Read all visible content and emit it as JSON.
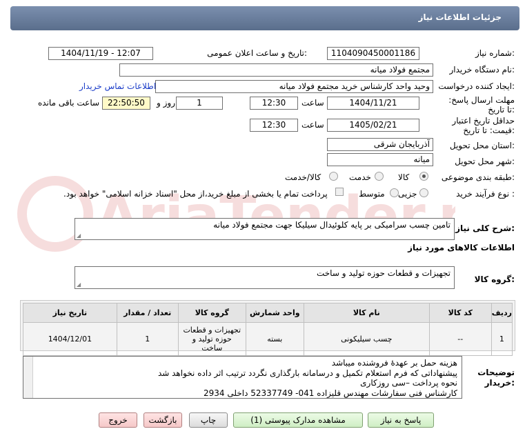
{
  "header": {
    "title": "جزئیات اطلاعات نیاز"
  },
  "fields": {
    "need_number_label": "شماره نیاز:",
    "need_number": "1104090450001186",
    "announce_label": "تاریخ و ساعت اعلان عمومی:",
    "announce_value": "1404/11/19 - 12:07",
    "buyer_label": "نام دستگاه خریدار:",
    "buyer_value": "مجتمع فولاد میانه",
    "creator_label": "ایجاد کننده درخواست:",
    "creator_value": "وحید واحد کارشناس خرید مجتمع فولاد میانه",
    "contact_link": "اطلاعات تماس خریدار",
    "deadline_label": "مهلت ارسال پاسخ: تا تاریخ:",
    "deadline_date": "1404/11/21",
    "time_label": "ساعت",
    "deadline_time": "12:30",
    "days_value": "1",
    "days_label": "روز و",
    "remaining_value": "22:50:50",
    "remaining_label": "ساعت باقی مانده",
    "validity_label": "حداقل تاریخ اعتبار قیمت: تا تاریخ:",
    "validity_date": "1405/02/21",
    "validity_time": "12:30",
    "province_label": "استان محل تحویل:",
    "province_value": "آذربایجان شرقی",
    "city_label": "شهر محل تحویل:",
    "city_value": "میانه",
    "category_label": "طبقه بندی موضوعی:",
    "category_options": [
      "کالا",
      "خدمت",
      "کالا/خدمت"
    ],
    "process_label": "نوع فرآیند خرید :",
    "process_options": [
      "جزیی",
      "متوسط"
    ],
    "payment_note": "پرداخت تمام یا بخشی از مبلغ خرید،از محل \"اسناد خزانه اسلامی\" خواهد بود."
  },
  "description": {
    "label": "شرح کلی نیاز:",
    "value": "تامین چسب سرامیکی بر پایه کلوئیدال سیلیکا جهت مجتمع فولاد میانه"
  },
  "goods_info_label": "اطلاعات کالاهای مورد نیاز",
  "goods_group": {
    "label": "گروه کالا:",
    "value": "تجهیزات و قطعات حوزه تولید و ساخت"
  },
  "table": {
    "headers": [
      "ردیف",
      "کد کالا",
      "نام کالا",
      "واحد شمارش",
      "گروه کالا",
      "تعداد / مقدار",
      "تاریخ نیاز"
    ],
    "rows": [
      [
        "1",
        "--",
        "چسب سیلیکونی",
        "بسته",
        "تجهیزات و قطعات حوزه تولید و ساخت",
        "1",
        "1404/12/01"
      ]
    ]
  },
  "notes": {
    "label": "توضیحات خریدار:",
    "lines": [
      "هزینه حمل بر عهدهٔ فروشنده میباشد",
      "پیشنهاداتی که فرم استعلام تکمیل و درسامانه بارگذاری نگردد ترتیب اثر داده نخواهد شد",
      "نحوه پرداخت –سی روزکاری",
      "کارشناس فنی سفارشات مهندس قلیزاده   041- 52337749  داخلی 2934"
    ]
  },
  "buttons": {
    "reply": "پاسخ به نیاز",
    "docs": "مشاهده مدارک پیوستی (1)",
    "print": "چاپ",
    "back": "بازگشت",
    "exit": "خروج"
  },
  "watermark": "AriaTender.net",
  "colors": {
    "header": "#5a6e8c",
    "link": "#1a3cc8",
    "yellow": "#fffac8"
  }
}
